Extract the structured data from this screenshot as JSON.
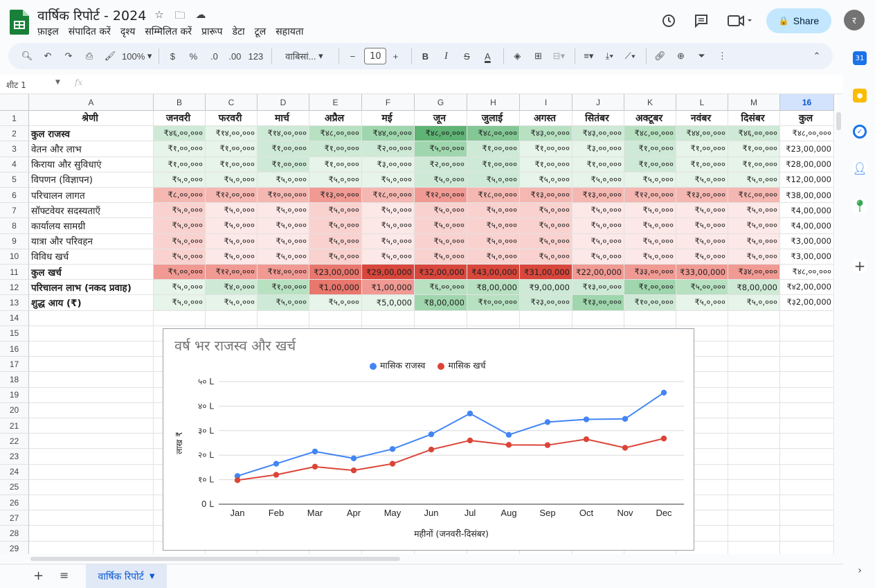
{
  "app": {
    "title": "वार्षिक रिपोर्ट - 2024",
    "share_label": "Share",
    "avatar_initial": "र",
    "brand_color": "#188038"
  },
  "menu": [
    "फ़ाइल",
    "संपादित करें",
    "दृश्य",
    "सम्मिलित करें",
    "प्रारूप",
    "डेटा",
    "टूल",
    "सहायता"
  ],
  "toolbar": {
    "zoom": "100%",
    "currency": "$",
    "percent": "%",
    "dec_less": ".0",
    "dec_more": ".00",
    "format_123": "123",
    "font": "वाबिसां...",
    "font_size": "10"
  },
  "formula_bar": {
    "name_box": "शीट 1",
    "fx": "fx"
  },
  "grid": {
    "columns": [
      "A",
      "B",
      "C",
      "D",
      "E",
      "F",
      "G",
      "H",
      "I",
      "J",
      "K",
      "L",
      "M",
      "16"
    ],
    "selected_column": "16",
    "row_numbers": [
      "1",
      "2",
      "3",
      "4",
      "5",
      "6",
      "7",
      "8",
      "9",
      "10",
      "11",
      "12",
      "13",
      "14",
      "15",
      "16",
      "17",
      "18",
      "19",
      "20",
      "21",
      "22",
      "23",
      "24",
      "25",
      "26",
      "27",
      "28",
      "29"
    ],
    "rows": [
      [
        "श्रेणी",
        "जनवरी",
        "फरवरी",
        "मार्च",
        "अप्रैल",
        "मई",
        "जून",
        "जुलाई",
        "अगस्त",
        "सितंबर",
        "अक्टूबर",
        "नवंबर",
        "दिसंबर",
        "कुल"
      ],
      [
        "कुल राजस्व",
        "₹४६,००,०००",
        "₹१४,००,०००",
        "₹१४,००,०००",
        "₹४८,००,०००",
        "₹४४,००,०००",
        "₹४८,००,०००",
        "₹४८,००,०००",
        "₹४३,००,०००",
        "₹४३,००,०००",
        "₹४८,००,०००",
        "₹४४,००,०००",
        "₹४६,००,०००",
        "₹४८,००,०००"
      ],
      [
        "वेतन और लाभ",
        "₹१,००,०००",
        "₹१,००,०००",
        "₹१,००,०००",
        "₹१,००,०००",
        "₹२,००,०००",
        "₹५,००,०००",
        "₹१,००,०००",
        "₹१,००,०००",
        "₹३,००,०००",
        "₹१,००,०००",
        "₹१,००,०००",
        "₹१,००,०००",
        "₹23,00,000"
      ],
      [
        "किराया और सुविधाएं",
        "₹१,००,०००",
        "₹१,००,०००",
        "₹१,००,०००",
        "₹१,००,०००",
        "₹३,००,०००",
        "₹२,००,०००",
        "₹१,००,०००",
        "₹१,००,०००",
        "₹१,००,०००",
        "₹१,००,०००",
        "₹१,००,०००",
        "₹१,००,०००",
        "₹28,00,000"
      ],
      [
        "विपणन (विज्ञापन)",
        "₹५,०,०००",
        "₹५,०,०००",
        "₹५,०,०००",
        "₹५,०,०००",
        "₹५,०,०००",
        "₹५,०,०००",
        "₹५,०,०००",
        "₹५,०,०००",
        "₹५,०,०००",
        "₹५,०,०००",
        "₹५,०,०००",
        "₹५,०,०००",
        "₹12,00,000"
      ],
      [
        "परिचालन लागत",
        "₹८,००,०००",
        "₹१२,००,०००",
        "₹१०,००,०००",
        "₹१३,००,०००",
        "₹१८,००,०००",
        "₹१२,००,०००",
        "₹१८,००,०००",
        "₹१३,००,०००",
        "₹१३,००,०००",
        "₹१२,००,०००",
        "₹१३,००,०००",
        "₹१८,००,०००",
        "₹38,00,000"
      ],
      [
        "सॉफ्टवेयर सदस्यताएँ",
        "₹५,०,०००",
        "₹५,०,०००",
        "₹५,०,०००",
        "₹५,०,०००",
        "₹५,०,०००",
        "₹५,०,०००",
        "₹५,०,०००",
        "₹५,०,०००",
        "₹५,०,०००",
        "₹५,०,०००",
        "₹५,०,०००",
        "₹५,०,०००",
        "₹4,00,000"
      ],
      [
        "कार्यालय सामग्री",
        "₹५,०,०००",
        "₹५,०,०००",
        "₹५,०,०००",
        "₹५,०,०००",
        "₹५,०,०००",
        "₹५,०,०००",
        "₹५,०,०००",
        "₹५,०,०००",
        "₹५,०,०००",
        "₹५,०,०००",
        "₹५,०,०००",
        "₹५,०,०००",
        "₹4,00,000"
      ],
      [
        "यात्रा और परिवहन",
        "₹५,०,०००",
        "₹५,०,०००",
        "₹५,०,०००",
        "₹५,०,०००",
        "₹५,०,०००",
        "₹५,०,०००",
        "₹५,०,०००",
        "₹५,०,०००",
        "₹५,०,०००",
        "₹५,०,०००",
        "₹५,०,०००",
        "₹५,०,०००",
        "₹3,00,000"
      ],
      [
        "विविध खर्च",
        "₹५,०,०००",
        "₹५,०,०००",
        "₹५,०,०००",
        "₹५,०,०००",
        "₹५,०,०००",
        "₹५,०,०००",
        "₹५,०,०००",
        "₹५,०,०००",
        "₹५,०,०००",
        "₹५,०,०००",
        "₹५,०,०००",
        "₹५,०,०००",
        "₹3,00,000"
      ],
      [
        "कुल खर्च",
        "₹९,००,०००",
        "₹१२,००,०००",
        "₹१४,००,०००",
        "₹23,00,000",
        "₹29,00,000",
        "₹32,00,000",
        "₹43,00,000",
        "₹31,00,000",
        "₹22,00,000",
        "₹३३,००,०००",
        "₹33,00,000",
        "₹३४,००,०००",
        "₹४८,००,०००"
      ],
      [
        "परिचालन लाभ (नकद प्रवाह)",
        "₹५,०,०००",
        "₹४,०,०००",
        "₹१,००,०००",
        "₹1,00,000",
        "₹1,00,000",
        "₹६,००,०००",
        "₹8,00,000",
        "₹9,00,000",
        "₹१३,००,०००",
        "₹१,००,०००",
        "₹५,००,०००",
        "₹8,00,000",
        "₹४2,00,000"
      ],
      [
        "शुद्ध आय (₹)",
        "₹५,०,०००",
        "₹५,०,०००",
        "₹५,०,०००",
        "₹५,०,०००",
        "₹5,0,000",
        "₹8,00,000",
        "₹१०,००,०००",
        "₹२३,००,०००",
        "₹१३,००,०००",
        "₹१०,००,०००",
        "₹५,०,०००",
        "₹५,०,०००",
        "₹३2,00,000"
      ]
    ],
    "heatmap": {
      "green": [
        "#ffffff",
        "#e6f4ea",
        "#ceead6",
        "#b7e1c1",
        "#9fd6ad",
        "#84c795",
        "#5fb374"
      ],
      "red": [
        "#ffffff",
        "#fce8e6",
        "#f9d2cf",
        "#f5b7b1",
        "#f09a93",
        "#e9776e",
        "#d9473c"
      ],
      "levels": [
        [
          2,
          1,
          2,
          3,
          4,
          6,
          5,
          3,
          2,
          3,
          2,
          2
        ],
        [
          1,
          1,
          2,
          2,
          2,
          4,
          2,
          1,
          1,
          2,
          1,
          1
        ],
        [
          1,
          1,
          2,
          1,
          1,
          2,
          2,
          1,
          1,
          2,
          1,
          1
        ],
        [
          1,
          1,
          1,
          1,
          1,
          2,
          2,
          1,
          1,
          1,
          1,
          1
        ],
        [
          3,
          3,
          3,
          4,
          3,
          4,
          3,
          3,
          3,
          3,
          3,
          3
        ],
        [
          2,
          1,
          1,
          2,
          1,
          2,
          2,
          2,
          1,
          1,
          1,
          1
        ],
        [
          2,
          1,
          1,
          2,
          1,
          2,
          2,
          2,
          1,
          1,
          1,
          1
        ],
        [
          2,
          1,
          1,
          2,
          1,
          2,
          2,
          2,
          1,
          1,
          1,
          1
        ],
        [
          2,
          1,
          1,
          2,
          1,
          2,
          2,
          2,
          1,
          1,
          1,
          1
        ],
        [
          4,
          4,
          4,
          5,
          6,
          6,
          6,
          6,
          4,
          4,
          4,
          4
        ],
        [
          1,
          2,
          3,
          5,
          4,
          3,
          3,
          2,
          2,
          4,
          3,
          2
        ],
        [
          1,
          1,
          2,
          1,
          1,
          4,
          3,
          2,
          4,
          2,
          1,
          1
        ]
      ],
      "row_colors": [
        "green",
        "green",
        "green",
        "green",
        "red",
        "red",
        "red",
        "red",
        "red",
        "red",
        "mixed",
        "green"
      ],
      "mixed_row": [
        "green",
        "green",
        "green",
        "red",
        "red",
        "green",
        "green",
        "green",
        "green",
        "green",
        "green",
        "green"
      ]
    }
  },
  "chart_data": {
    "type": "line",
    "title": "वर्ष भर राजस्व और खर्च",
    "xlabel": "महीनों (जनवरी-दिसंबर)",
    "ylabel": "लाख ₹",
    "categories": [
      "Jan",
      "Feb",
      "Mar",
      "Apr",
      "May",
      "Jun",
      "Jul",
      "Aug",
      "Sep",
      "Oct",
      "Nov",
      "Dec"
    ],
    "yticks": [
      "0 L",
      "१० L",
      "२० L",
      "३० L",
      "४० L",
      "५० L"
    ],
    "ylim": [
      0,
      50
    ],
    "grid": true,
    "legend_position": "top",
    "series": [
      {
        "name": "मासिक राजस्व",
        "color": "#4285f4",
        "values": [
          11.5,
          16.5,
          21.5,
          18.7,
          22.5,
          28.5,
          37,
          28.3,
          33.5,
          34.6,
          34.8,
          45.5
        ]
      },
      {
        "name": "मासिक खर्च",
        "color": "#db4437",
        "values": [
          9.8,
          12,
          15.3,
          13.8,
          16.5,
          22.3,
          26,
          24.2,
          24.1,
          26.5,
          23,
          26.8
        ]
      }
    ]
  },
  "sheets": {
    "active": "वार्षिक रिपोर्ट"
  }
}
